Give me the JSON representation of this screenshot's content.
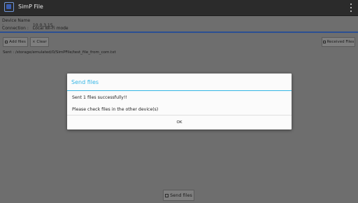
{
  "app": {
    "title": "SimP File",
    "icon": "app-window-icon",
    "menu_icon": "overflow-menu-icon"
  },
  "info": {
    "device_label": "Device Name :",
    "device_value": "10.0.3.15",
    "connection_label": "Connection :",
    "connection_value": "Local Wi-Fi mode"
  },
  "toolbar": {
    "add_files_label": "Add files",
    "clear_label": "Clear",
    "received_files_label": "Received Files"
  },
  "sent_path": "Sent : /storage/emulated/0/SimPFile/test_file_from_com.txt",
  "dialog": {
    "title": "Send files",
    "message_1": "Sent 1 files successfully!!",
    "message_2": "Please check files in the other device(s)",
    "ok_label": "OK"
  },
  "footer": {
    "send_files_label": "Send files"
  },
  "colors": {
    "accent": "#33b5e5",
    "titlebar": "#2b2b2b",
    "divider": "#2b4f93",
    "overlay_background": "#6e6e6e"
  }
}
